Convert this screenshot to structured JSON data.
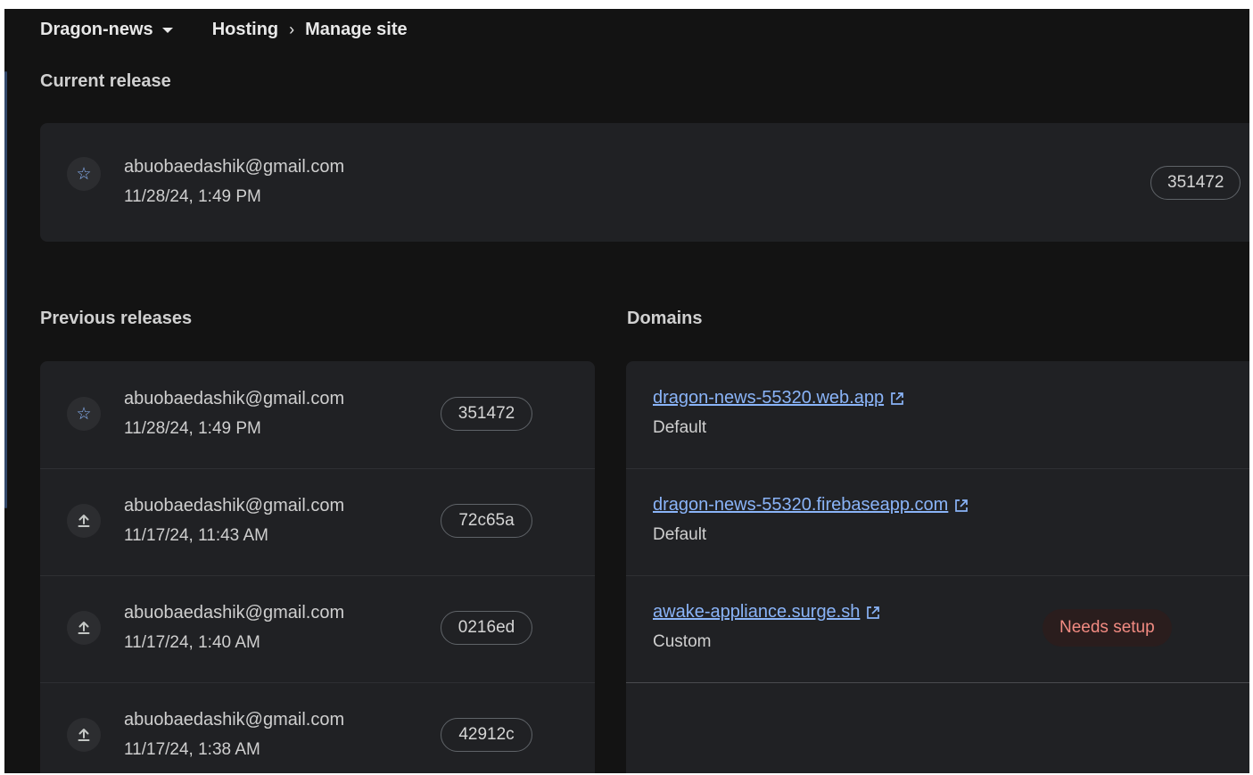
{
  "header": {
    "project_name": "Dragon-news",
    "breadcrumb": {
      "parent": "Hosting",
      "separator": "›",
      "current": "Manage site"
    }
  },
  "current_release": {
    "section_title": "Current release",
    "icon": "star-icon",
    "email": "abuobaedashik@gmail.com",
    "date": "11/28/24, 1:49 PM",
    "version": "351472"
  },
  "previous_releases": {
    "section_title": "Previous releases",
    "items": [
      {
        "icon": "star-icon",
        "email": "abuobaedashik@gmail.com",
        "date": "11/28/24, 1:49 PM",
        "version": "351472"
      },
      {
        "icon": "upload-icon",
        "email": "abuobaedashik@gmail.com",
        "date": "11/17/24, 11:43 AM",
        "version": "72c65a"
      },
      {
        "icon": "upload-icon",
        "email": "abuobaedashik@gmail.com",
        "date": "11/17/24, 1:40 AM",
        "version": "0216ed"
      },
      {
        "icon": "upload-icon",
        "email": "abuobaedashik@gmail.com",
        "date": "11/17/24, 1:38 AM",
        "version": "42912c"
      }
    ]
  },
  "domains": {
    "section_title": "Domains",
    "items": [
      {
        "url": "dragon-news-55320.web.app",
        "type": "Default"
      },
      {
        "url": "dragon-news-55320.firebaseapp.com",
        "type": "Default"
      },
      {
        "url": "awake-appliance.surge.sh",
        "type": "Custom",
        "status": "Needs setup"
      }
    ]
  },
  "colors": {
    "background": "#131313",
    "card": "#202124",
    "link": "#8ab4f8",
    "warning_text": "#f28b82",
    "warning_bg": "#2a1d1d"
  }
}
